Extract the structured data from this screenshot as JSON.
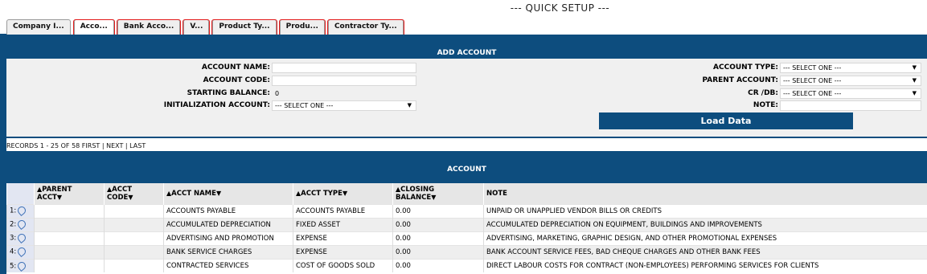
{
  "page_title": "--- QUICK SETUP ---",
  "tabs": [
    {
      "label": "Company I...",
      "active": false,
      "marked": false
    },
    {
      "label": "Acco...",
      "active": true,
      "marked": true
    },
    {
      "label": "Bank Acco...",
      "active": false,
      "marked": true
    },
    {
      "label": "V...",
      "active": false,
      "marked": true
    },
    {
      "label": "Product Ty...",
      "active": false,
      "marked": true
    },
    {
      "label": "Produ...",
      "active": false,
      "marked": true
    },
    {
      "label": "Contractor Ty...",
      "active": false,
      "marked": true
    }
  ],
  "add_account": {
    "header": "ADD ACCOUNT",
    "account_name_label": "ACCOUNT NAME:",
    "account_name_value": "",
    "account_code_label": "ACCOUNT CODE:",
    "account_code_value": "",
    "starting_balance_label": "STARTING BALANCE:",
    "starting_balance_value": "0",
    "init_account_label": "INITIALIZATION ACCOUNT:",
    "init_account_value": "--- SELECT ONE ---",
    "account_type_label": "ACCOUNT TYPE:",
    "account_type_value": "--- SELECT ONE ---",
    "parent_account_label": "PARENT ACCOUNT:",
    "parent_account_value": "--- SELECT ONE ---",
    "crdb_label": "CR /DB:",
    "crdb_value": "--- SELECT ONE ---",
    "note_label": "NOTE:",
    "note_value": "",
    "load_button": "Load Data",
    "dropdown_arrow": "▼"
  },
  "records": {
    "text": "RECORDS 1 - 25 OF 58",
    "first": "FIRST",
    "next": "NEXT",
    "last": "LAST",
    "sep": "|"
  },
  "account_table": {
    "header": "ACCOUNT",
    "sort_up": "≈",
    "columns": {
      "parent_acct_1": "PARENT",
      "parent_acct_2": "ACCT",
      "acct_code_1": "ACCT",
      "acct_code_2": "CODE",
      "acct_name": "ACCT NAME",
      "acct_type": "ACCT TYPE",
      "closing_balance_1": "CLOSING",
      "closing_balance_2": "BALANCE",
      "note": "NOTE"
    },
    "rows": [
      {
        "num": "1:",
        "parent": "",
        "code": "",
        "name": "ACCOUNTS PAYABLE",
        "type": "ACCOUNTS PAYABLE",
        "balance": "0.00",
        "note": "UNPAID OR UNAPPLIED VENDOR BILLS OR CREDITS"
      },
      {
        "num": "2:",
        "parent": "",
        "code": "",
        "name": "ACCUMULATED DEPRECIATION",
        "type": "FIXED ASSET",
        "balance": "0.00",
        "note": "ACCUMULATED DEPRECIATION ON EQUIPMENT, BUILDINGS AND IMPROVEMENTS"
      },
      {
        "num": "3:",
        "parent": "",
        "code": "",
        "name": "ADVERTISING AND PROMOTION",
        "type": "EXPENSE",
        "balance": "0.00",
        "note": "ADVERTISING, MARKETING, GRAPHIC DESIGN, AND OTHER PROMOTIONAL EXPENSES"
      },
      {
        "num": "4:",
        "parent": "",
        "code": "",
        "name": "BANK SERVICE CHARGES",
        "type": "EXPENSE",
        "balance": "0.00",
        "note": "BANK ACCOUNT SERVICE FEES, BAD CHEQUE CHARGES AND OTHER BANK FEES"
      },
      {
        "num": "5:",
        "parent": "",
        "code": "",
        "name": "CONTRACTED SERVICES",
        "type": "COST OF GOODS SOLD",
        "balance": "0.00",
        "note": "DIRECT LABOUR COSTS FOR CONTRACT (NON-EMPLOYEES) PERFORMING SERVICES FOR CLIENTS"
      }
    ]
  },
  "colors": {
    "header_blue": "#0d4d7e",
    "annotation_red": "#e31b1b"
  }
}
